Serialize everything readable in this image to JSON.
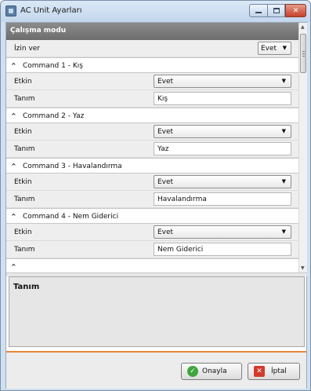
{
  "window": {
    "title": "AC Unit Ayarları",
    "minimize_glyph": "",
    "close_glyph": "✕"
  },
  "category": {
    "label": "Çalışma modu"
  },
  "permission": {
    "label": "İzin ver",
    "value": "Evet"
  },
  "groups": [
    {
      "header": "Command 1 - Kış",
      "enabled_label": "Etkin",
      "enabled_value": "Evet",
      "name_label": "Tanım",
      "name_value": "Kış"
    },
    {
      "header": "Command 2 - Yaz",
      "enabled_label": "Etkin",
      "enabled_value": "Evet",
      "name_label": "Tanım",
      "name_value": "Yaz"
    },
    {
      "header": "Command 3 - Havalandırma",
      "enabled_label": "Etkin",
      "enabled_value": "Evet",
      "name_label": "Tanım",
      "name_value": "Havalandırma"
    },
    {
      "header": "Command 4 - Nem Giderici",
      "enabled_label": "Etkin",
      "enabled_value": "Evet",
      "name_label": "Tanım",
      "name_value": "Nem Giderici"
    }
  ],
  "description": {
    "title": "Tanım"
  },
  "buttons": {
    "ok": "Onayla",
    "cancel": "İptal"
  },
  "icons": {
    "caret": "^",
    "dropdown": "▼",
    "ok": "✓",
    "cancel": "✕",
    "scroll_up": "▲",
    "scroll_down": "▼"
  },
  "colors": {
    "category_bg": "#7d7d7d",
    "accent_line": "#e8873b",
    "ok_icon": "#3fa63f",
    "cancel_icon": "#d33a2c"
  }
}
